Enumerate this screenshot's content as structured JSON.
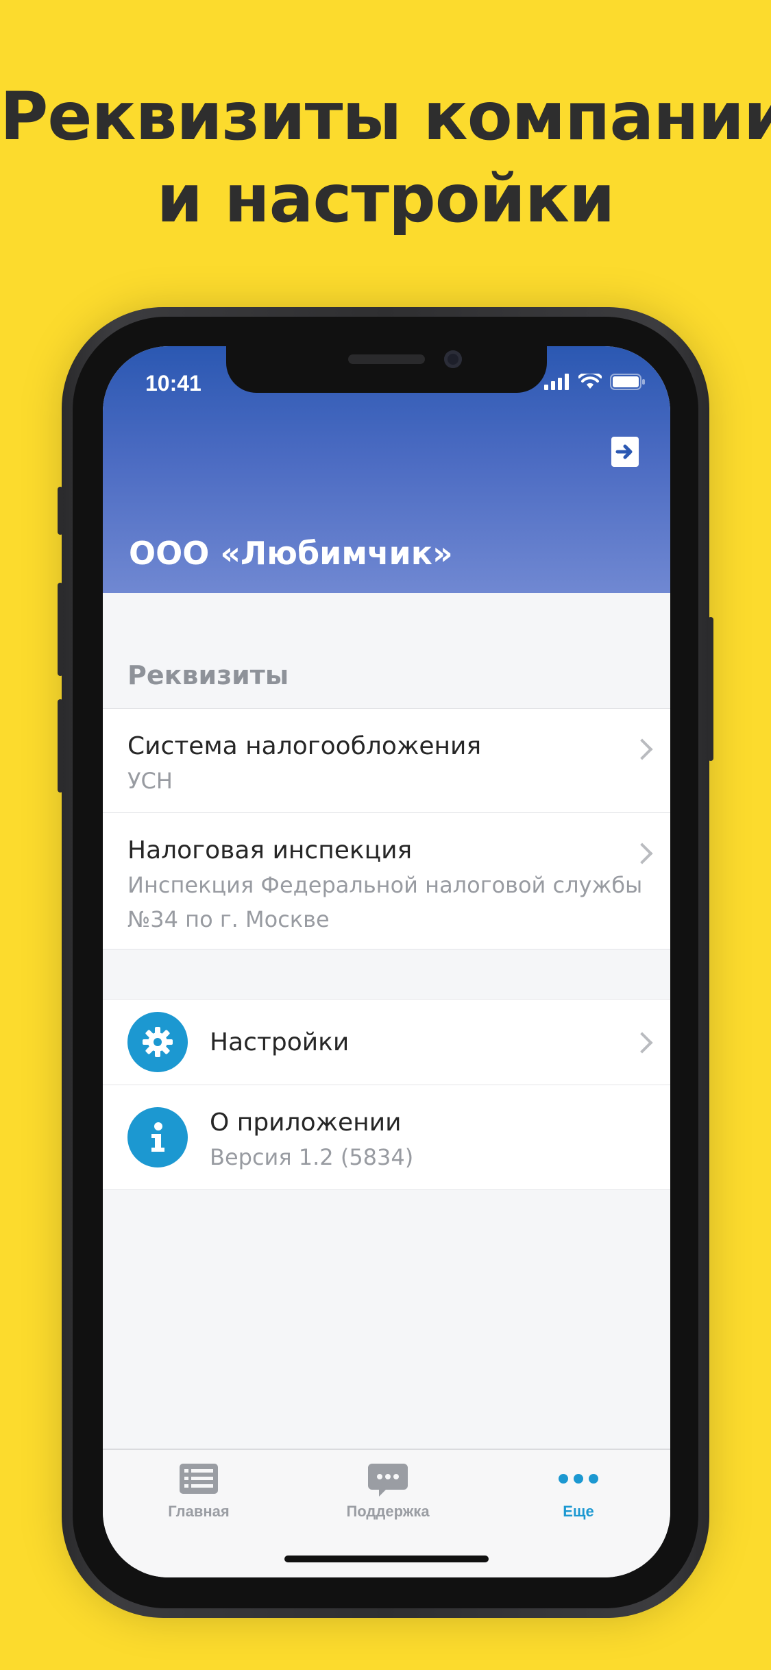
{
  "headline": {
    "line1": "Реквизиты компании",
    "line2": "и настройки"
  },
  "status_bar": {
    "time": "10:41"
  },
  "header": {
    "company_name": "ООО «Любимчик»",
    "logout_icon": "logout-icon"
  },
  "requisites": {
    "section_title": "Реквизиты",
    "items": [
      {
        "title": "Система налогообложения",
        "subtitle_lines": [
          "УСН"
        ]
      },
      {
        "title": "Налоговая инспекция",
        "subtitle_lines": [
          "Инспекция Федеральной налоговой службы",
          "№34 по г. Москве"
        ]
      }
    ]
  },
  "menu": {
    "settings": {
      "title": "Настройки",
      "icon": "gear-icon"
    },
    "about": {
      "title": "О приложении",
      "subtitle": "Версия 1.2 (5834)",
      "icon": "info-icon"
    }
  },
  "tabbar": {
    "tabs": [
      {
        "label": "Главная",
        "icon": "list-icon",
        "active": false
      },
      {
        "label": "Поддержка",
        "icon": "chat-bubble-icon",
        "active": false
      },
      {
        "label": "Еще",
        "icon": "more-dots-icon",
        "active": true
      }
    ]
  },
  "colors": {
    "background": "#FCDB2D",
    "header_top": "#2B58B2",
    "header_bottom": "#7088D2",
    "accent": "#1C98D1"
  }
}
